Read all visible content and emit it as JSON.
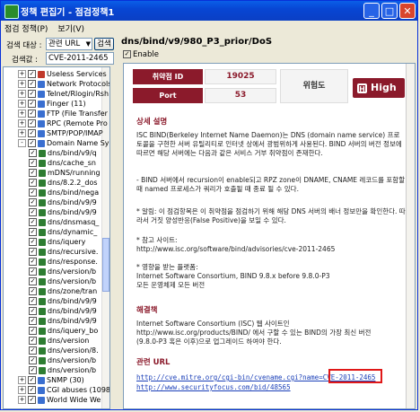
{
  "window": {
    "title": "정책 편집기 - 점검정책1"
  },
  "menu": [
    "점검 정책(P)",
    "보기(V)"
  ],
  "search": {
    "target_label": "검색 대상 :",
    "target_value": "관련 URL",
    "search_button": "검색",
    "value_label": "검색값 :",
    "value": "CVE-2011-2465"
  },
  "tree": [
    {
      "label": "Useless Services",
      "exp": "+",
      "chk": "✓",
      "icon": "red"
    },
    {
      "label": "Network Protocols",
      "exp": "+",
      "chk": "✓",
      "icon": "blu"
    },
    {
      "label": "Telnet/Rlogin/Rsh",
      "exp": "+",
      "chk": "✓",
      "icon": "blu"
    },
    {
      "label": "Finger (11)",
      "exp": "+",
      "chk": "✓",
      "icon": "blu"
    },
    {
      "label": "FTP (File Transfer",
      "exp": "+",
      "chk": "✓",
      "icon": "blu"
    },
    {
      "label": "RPC (Remote Pro",
      "exp": "+",
      "chk": "✓",
      "icon": "blu"
    },
    {
      "label": "SMTP/POP/IMAP",
      "exp": "+",
      "chk": "✓",
      "icon": "blu"
    },
    {
      "label": "Domain Name Sy",
      "exp": "-",
      "chk": "✓",
      "icon": "blu"
    },
    {
      "label": "dns/bind/v9/q",
      "exp": "",
      "chk": "✓",
      "icon": "grn"
    },
    {
      "label": "dns/cache_sn",
      "exp": "",
      "chk": "✓",
      "icon": "grn"
    },
    {
      "label": "mDNS/running",
      "exp": "",
      "chk": "✓",
      "icon": "grn"
    },
    {
      "label": "dns/8.2.2_dos",
      "exp": "",
      "chk": "✓",
      "icon": "grn"
    },
    {
      "label": "dns/bind/nega",
      "exp": "",
      "chk": "✓",
      "icon": "grn"
    },
    {
      "label": "dns/bind/v9/9",
      "exp": "",
      "chk": "✓",
      "icon": "grn"
    },
    {
      "label": "dns/bind/v9/9",
      "exp": "",
      "chk": "✓",
      "icon": "grn"
    },
    {
      "label": "dns/dnsmasq_",
      "exp": "",
      "chk": "✓",
      "icon": "grn"
    },
    {
      "label": "dns/dynamic_",
      "exp": "",
      "chk": "✓",
      "icon": "grn"
    },
    {
      "label": "dns/iquery",
      "exp": "",
      "chk": "✓",
      "icon": "grn"
    },
    {
      "label": "dns/recursive.",
      "exp": "",
      "chk": "✓",
      "icon": "grn"
    },
    {
      "label": "dns/response.",
      "exp": "",
      "chk": "✓",
      "icon": "grn"
    },
    {
      "label": "dns/version/b",
      "exp": "",
      "chk": "✓",
      "icon": "grn"
    },
    {
      "label": "dns/version/b",
      "exp": "",
      "chk": "✓",
      "icon": "grn"
    },
    {
      "label": "dns/zone/tran",
      "exp": "",
      "chk": "✓",
      "icon": "grn"
    },
    {
      "label": "dns/bind/v9/9",
      "exp": "",
      "chk": "✓",
      "icon": "grn"
    },
    {
      "label": "dns/bind/v9/9",
      "exp": "",
      "chk": "✓",
      "icon": "grn"
    },
    {
      "label": "dns/bind/v9/9",
      "exp": "",
      "chk": "✓",
      "icon": "grn"
    },
    {
      "label": "dns/iquery_bo",
      "exp": "",
      "chk": "✓",
      "icon": "grn"
    },
    {
      "label": "dns/version",
      "exp": "",
      "chk": "✓",
      "icon": "grn"
    },
    {
      "label": "dns/version/8.",
      "exp": "",
      "chk": "✓",
      "icon": "grn"
    },
    {
      "label": "dns/version/b",
      "exp": "",
      "chk": "✓",
      "icon": "grn"
    },
    {
      "label": "dns/version/b",
      "exp": "",
      "chk": "✓",
      "icon": "grn"
    },
    {
      "label": "SNMP (30)",
      "exp": "+",
      "chk": "✓",
      "icon": "blu"
    },
    {
      "label": "CGI abuses (1098",
      "exp": "+",
      "chk": "✓",
      "icon": "blu"
    },
    {
      "label": "World Wide We",
      "exp": "+",
      "chk": "✓",
      "icon": "blu"
    }
  ],
  "detail": {
    "title": "dns/bind/v9/980_P3_prior/DoS",
    "enable_label": "Enable",
    "vuln_id_label": "취약점 ID",
    "vuln_id": "19025",
    "risk_label": "위험도",
    "risk_value": "High",
    "risk_icon_letter": "H",
    "port_label": "Port",
    "port": "53",
    "desc_title": "상세 설명",
    "desc_p1": "ISC BIND(Berkeley Internet Name Daemon)는 DNS (domain name service) 프로토콜을 구현한 서버 유틸리티로 인터넷 상에서 광범위하게 사용된다. BIND 서버의 버전 정보에 따르면 해당 서버에는 다음과 같은 서비스 거부 취약점이 존재한다.",
    "desc_p2": "- BIND 서버에서 recursion이 enable되고 RPZ zone이 DNAME, CNAME 레코드를 포함할 때 named 프로세스가 쿼리가 호출될 때 종료 될 수 있다.",
    "desc_p3": "* 알림: 이 점검항목은 이 취약점을 점검하기 위해 해당 DNS 서버의 배너 정보만을 확인한다. 따라서 거짓 양성반응(False Positive)을 보일 수 있다.",
    "desc_p4": "* 참고 사이트:\nhttp://www.isc.org/software/bind/advisories/cve-2011-2465",
    "desc_p5": "* 영향을 받는 플랫폼:\nInternet Software Consortium, BIND 9.8.x before 9.8.0-P3\n모든 운영체제 모든 버전",
    "fix_title": "해결책",
    "fix_p": "Internet Software Consortium (ISC) 웹 사이트인\nhttp://www.isc.org/products/BIND/ 에서 구할 수 있는 BIND의 가장 최신 버전\n(9.8.0-P3 혹은 이후)으로 업그레이드 하여야 한다.",
    "url_title": "관련 URL",
    "url1": "http://cve.mitre.org/cgi-bin/cvename.cgi?name=CVE-2011-2465",
    "url2": "http://www.securityfocus.com/bid/48565"
  }
}
